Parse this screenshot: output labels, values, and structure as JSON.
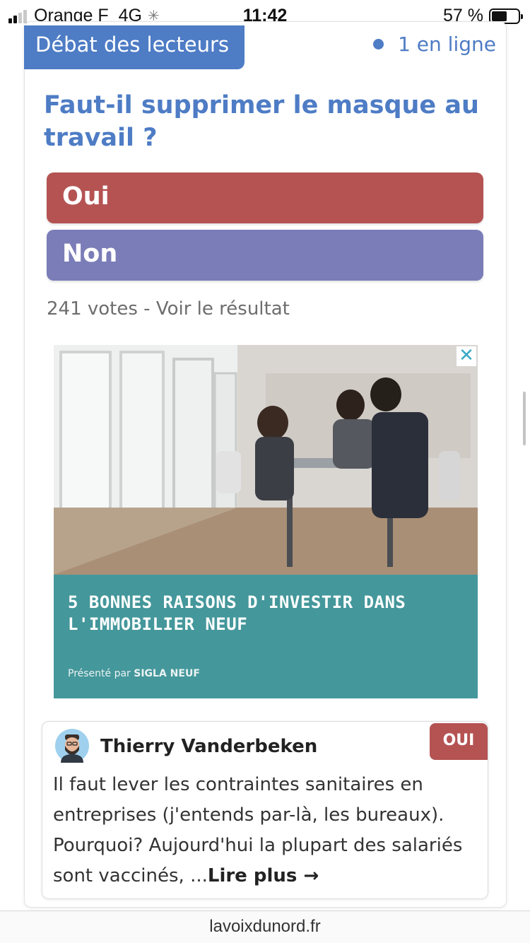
{
  "status_bar": {
    "carrier": "Orange F",
    "network": "4G",
    "time": "11:42",
    "battery_percent": "57 %",
    "battery_level": 0.57
  },
  "debate": {
    "tag_label": "Débat des lecteurs",
    "online_label": "1 en ligne",
    "question": "Faut-il supprimer le masque au travail ?",
    "options": [
      {
        "label": "Oui",
        "color": "#b55353"
      },
      {
        "label": "Non",
        "color": "#7b7db8"
      }
    ],
    "votes_text": "241 votes - Voir le résultat"
  },
  "ad": {
    "headline": "5 BONNES RAISONS D'INVESTIR DANS L'IMMOBILIER NEUF",
    "sponsor_prefix": "Présenté par",
    "sponsor_name": "SIGLA NEUF",
    "banner_color": "#44979b"
  },
  "comment": {
    "author": "Thierry Vanderbeken",
    "stance": "OUI",
    "text": "Il faut lever les contraintes sanitaires en entreprises (j'entends par-là, les bureaux). Pourquoi? Aujourd'hui la plupart des salariés sont vaccinés, ...",
    "read_more": "Lire plus"
  },
  "url_bar": {
    "domain": "lavoixdunord.fr"
  },
  "colors": {
    "accent_blue": "#4e7cc5",
    "oui_red": "#b55353",
    "non_purple": "#7b7db8"
  }
}
